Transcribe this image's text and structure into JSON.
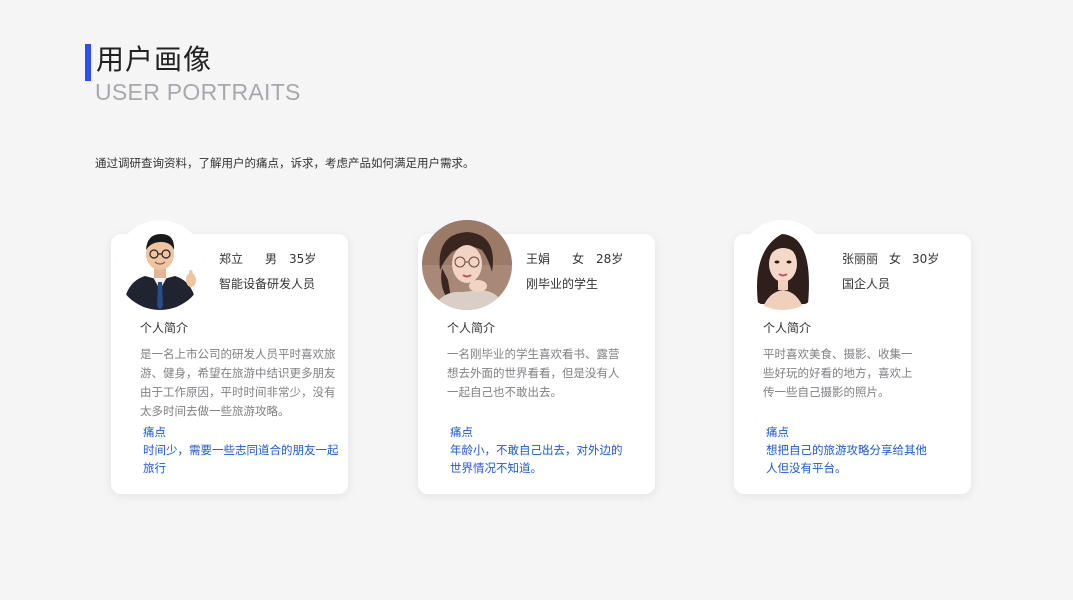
{
  "header": {
    "title_cn": "用户画像",
    "title_en": "USER PORTRAITS",
    "accent_color": "#2f4ef0"
  },
  "intro": "通过调研查询资料，了解用户的痛点，诉求，考虑产品如何满足用户需求。",
  "cards": [
    {
      "name": "郑立",
      "gender": "男",
      "age": "35岁",
      "role": "智能设备研发人员",
      "section_label": "个人简介",
      "description": "是一名上市公司的研发人员平时喜欢旅游、健身，希望在旅游中结识更多朋友由于工作原因，平时时间非常少，没有太多时间去做一些旅游攻略。",
      "pain_label": "痛点",
      "pain_text": "时间少，需要一些志同道合的朋友一起旅行",
      "avatar_icon": "man-in-suit-thumbs-up-photo"
    },
    {
      "name": "王娟",
      "gender": "女",
      "age": "28岁",
      "role": "刚毕业的学生",
      "section_label": "个人简介",
      "description": "一名刚毕业的学生喜欢看书、露营想去外面的世界看看，但是没有人一起自己也不敢出去。",
      "pain_label": "痛点",
      "pain_text": "年龄小，不敢自己出去，对外边的世界情况不知道。",
      "avatar_icon": "young-woman-with-glasses-photo"
    },
    {
      "name": "张丽丽",
      "gender": "女",
      "age": "30岁",
      "role": "国企人员",
      "section_label": "个人简介",
      "description": "平时喜欢美食、摄影、收集一些好玩的好看的地方，喜欢上传一些自己摄影的照片。",
      "pain_label": "痛点",
      "pain_text": "想把自己的旅游攻略分享给其他人但没有平台。",
      "avatar_icon": "woman-long-hair-portrait-photo"
    }
  ],
  "colors": {
    "background": "#f5f5f6",
    "pain_text": "#1d5bd6",
    "description_text": "#808086"
  }
}
